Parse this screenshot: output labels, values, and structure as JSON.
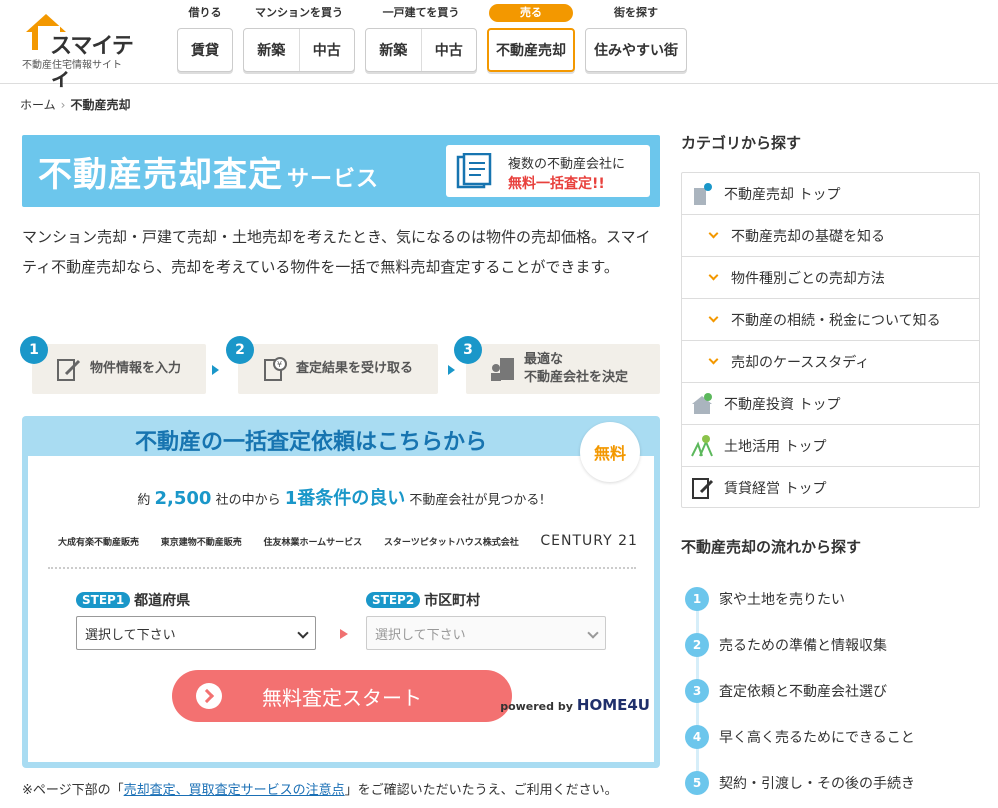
{
  "header": {
    "logo_text": "スマイティ",
    "logo_sub": "不動産住宅情報サイト",
    "nav": [
      {
        "caption": "借りる",
        "items": [
          "賃貸"
        ]
      },
      {
        "caption": "マンションを買う",
        "items": [
          "新築",
          "中古"
        ]
      },
      {
        "caption": "一戸建てを買う",
        "items": [
          "新築",
          "中古"
        ]
      },
      {
        "caption": "売る",
        "items": [
          "不動産売却"
        ]
      },
      {
        "caption": "街を探す",
        "items": [
          "住みやすい街"
        ]
      }
    ]
  },
  "breadcrumb": {
    "home": "ホーム",
    "current": "不動産売却"
  },
  "banner": {
    "title": "不動産売却査定",
    "title_suffix": "サービス",
    "box_line1": "複数の不動産会社に",
    "box_line2": "無料一括査定!!"
  },
  "intro": "マンション売却・戸建て売却・土地売却を考えたとき、気になるのは物件の売却価格。スマイティ不動産売却なら、売却を考えている物件を一括で無料売却査定することができます。",
  "steps": [
    {
      "num": "1",
      "label": "物件情報を入力"
    },
    {
      "num": "2",
      "label": "査定結果を受け取る"
    },
    {
      "num": "3",
      "label_line1": "最適な",
      "label_line2": "不動産会社を決定"
    }
  ],
  "form": {
    "title": "不動産の一括査定依頼はこちらから",
    "free_badge": "無料",
    "tagline_pre": "約",
    "tagline_count": "2,500",
    "tagline_mid": "社の中から",
    "tagline_best": "1番条件の良い",
    "tagline_post": "不動産会社が見つかる!",
    "companies": [
      "大成有楽不動産販売",
      "東京建物不動産販売",
      "住友林業ホームサービス",
      "スターツピタットハウス株式会社",
      "CENTURY 21"
    ],
    "step1_tag": "STEP1",
    "step1_label": "都道府県",
    "step1_value": "選択して下さい",
    "step2_tag": "STEP2",
    "step2_label": "市区町村",
    "step2_value": "選択して下さい",
    "start_label": "無料査定スタート",
    "powered_by": "powered by",
    "powered_brand": "HOME4U"
  },
  "note": {
    "pre": "※ページ下部の「",
    "link": "売却査定、買取査定サービスの注意点",
    "post": "」をご確認いただいたうえ、ご利用ください。"
  },
  "sidebar": {
    "cat_heading": "カテゴリから探す",
    "categories": [
      {
        "label": "不動産売却 トップ",
        "icon": "building-icon",
        "sub": false
      },
      {
        "label": "不動産売却の基礎を知る",
        "sub": true
      },
      {
        "label": "物件種別ごとの売却方法",
        "sub": true
      },
      {
        "label": "不動産の相続・税金について知る",
        "sub": true
      },
      {
        "label": "売却のケーススタディ",
        "sub": true
      },
      {
        "label": "不動産投資 トップ",
        "icon": "house-icon",
        "sub": false
      },
      {
        "label": "土地活用 トップ",
        "icon": "land-icon",
        "sub": false
      },
      {
        "label": "賃貸経営 トップ",
        "icon": "document-icon",
        "sub": false
      }
    ],
    "flow_heading": "不動産売却の流れから探す",
    "flow": [
      {
        "num": "1",
        "label": "家や土地を売りたい"
      },
      {
        "num": "2",
        "label": "売るための準備と情報収集"
      },
      {
        "num": "3",
        "label": "査定依頼と不動産会社選び"
      },
      {
        "num": "4",
        "label": "早く高く売るためにできること"
      },
      {
        "num": "5",
        "label": "契約・引渡し・その後の手続き"
      }
    ]
  },
  "colors": {
    "accent": "#f39800",
    "blue": "#1a97c9",
    "banner": "#6cc6ec",
    "cta": "#f37171"
  }
}
